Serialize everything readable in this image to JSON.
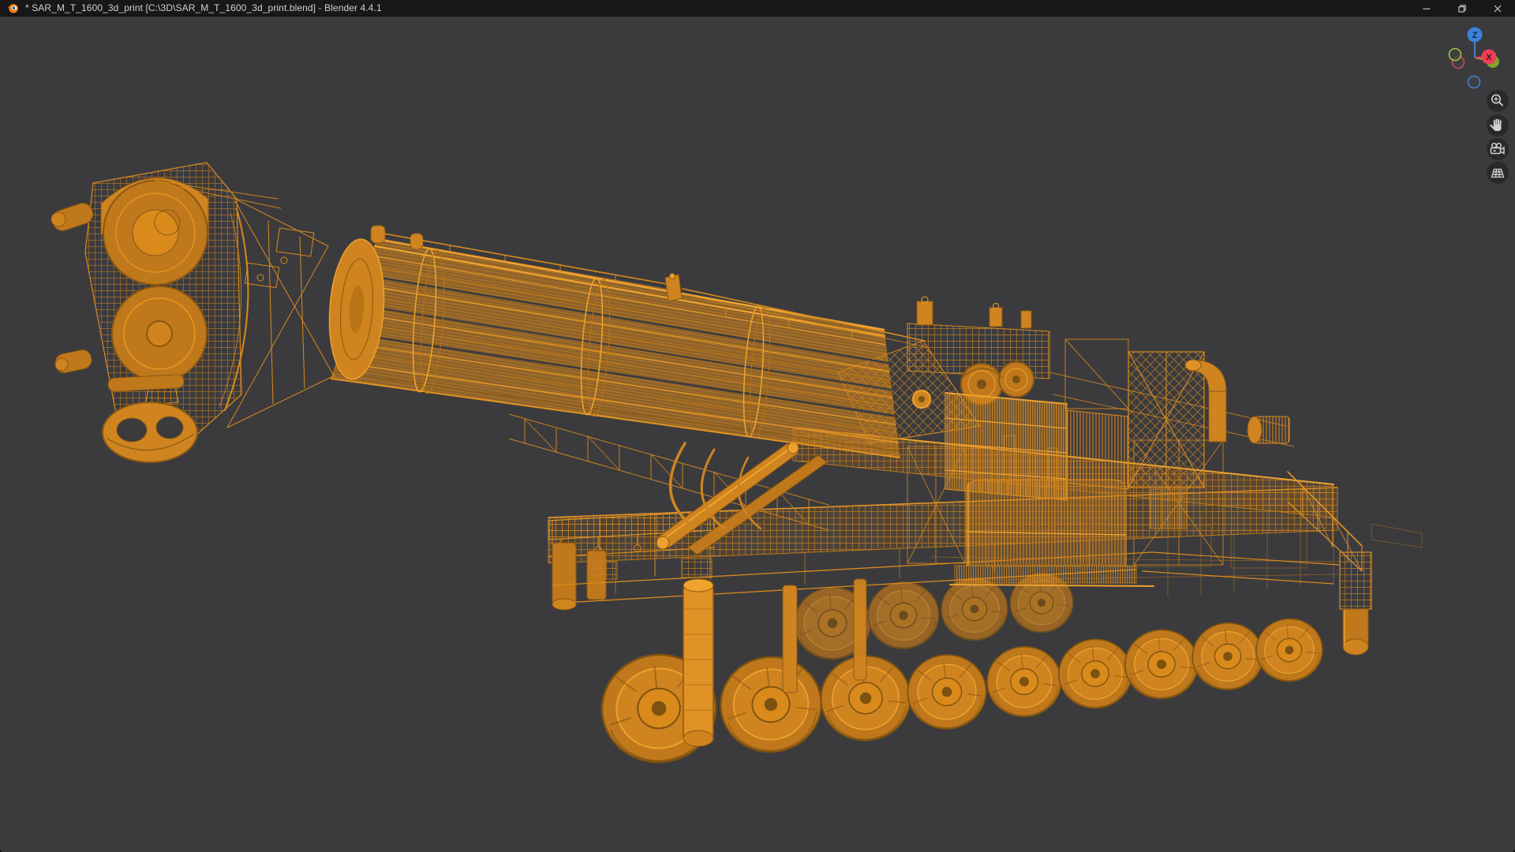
{
  "window": {
    "title": "* SAR_M_T_1600_3d_print [C:\\3D\\SAR_M_T_1600_3d_print.blend] - Blender 4.4.1",
    "app_name": "Blender 4.4.1",
    "controls": [
      "minimize",
      "restore",
      "close"
    ]
  },
  "viewport": {
    "shading": "wireframe",
    "gizmo": {
      "x_label": "X",
      "z_label": "Z"
    },
    "nav_buttons": [
      "zoom",
      "pan",
      "camera-view",
      "projection-toggle"
    ]
  },
  "colors": {
    "viewport-bg": "#3b3b3e",
    "titlebar-bg": "#181818",
    "titlebar-text": "#d0d0d0",
    "wire": "#d98a1a",
    "wire-bright": "#eda22e",
    "axis-x": "#ee3e55",
    "axis-y": "#8fbb2a",
    "axis-z": "#3d82d8"
  }
}
